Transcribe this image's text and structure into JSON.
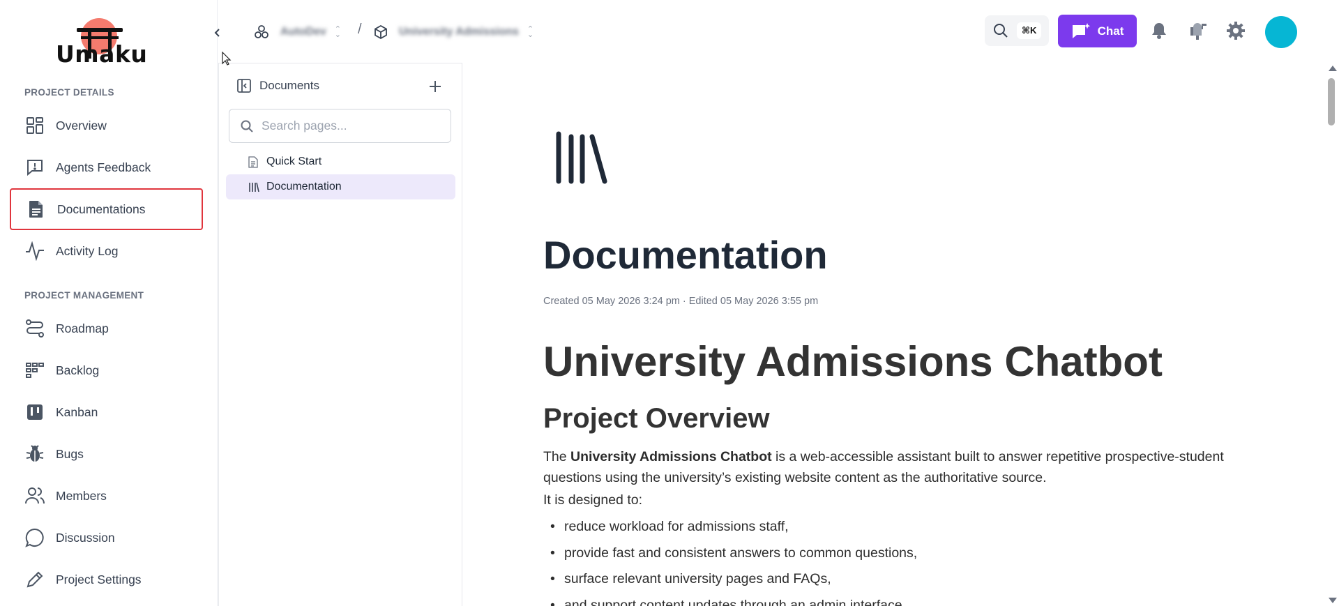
{
  "app": {
    "logo_text": "Umaku"
  },
  "sidebar": {
    "sections": [
      {
        "label": "PROJECT DETAILS"
      },
      {
        "label": "PROJECT MANAGEMENT"
      }
    ],
    "items": [
      {
        "label": "Overview",
        "icon": "grid-icon"
      },
      {
        "label": "Agents Feedback",
        "icon": "feedback-icon"
      },
      {
        "label": "Documentations",
        "icon": "document-icon",
        "selected": true
      },
      {
        "label": "Activity Log",
        "icon": "activity-icon"
      },
      {
        "label": "Roadmap",
        "icon": "roadmap-icon"
      },
      {
        "label": "Backlog",
        "icon": "backlog-icon"
      },
      {
        "label": "Kanban",
        "icon": "kanban-icon"
      },
      {
        "label": "Bugs",
        "icon": "bug-icon"
      },
      {
        "label": "Members",
        "icon": "members-icon"
      },
      {
        "label": "Discussion",
        "icon": "discussion-icon"
      },
      {
        "label": "Project Settings",
        "icon": "pencil-icon"
      }
    ]
  },
  "header": {
    "breadcrumb": [
      {
        "label": "AutoDev"
      },
      {
        "label": "University Admissions"
      }
    ],
    "separator": "/",
    "search_shortcut": "⌘K",
    "chat_label": "Chat"
  },
  "docs_panel": {
    "title": "Documents",
    "search_placeholder": "Search pages...",
    "pages": [
      {
        "label": "Quick Start",
        "icon": "page-icon"
      },
      {
        "label": "Documentation",
        "icon": "library-icon",
        "active": true
      }
    ]
  },
  "document": {
    "title": "Documentation",
    "meta": "Created 05 May 2026 3:24 pm · Edited 05 May 2026 3:55 pm",
    "h1": "University Admissions Chatbot",
    "h2": "Project Overview",
    "para_prefix": "The ",
    "para_bold": "University Admissions Chatbot",
    "para_rest": " is a web-accessible assistant built to answer repetitive prospective-student questions using the university’s existing website content as the authoritative source.",
    "para2": "It is designed to:",
    "bullets": [
      "reduce workload for admissions staff,",
      "provide fast and consistent answers to common questions,",
      "surface relevant university pages and FAQs,",
      "and support content updates through an admin interface."
    ]
  },
  "colors": {
    "accent": "#7c3aed",
    "selected_border": "#e0353d",
    "avatar": "#06b6d4",
    "active_page_bg": "#ede9fb"
  }
}
